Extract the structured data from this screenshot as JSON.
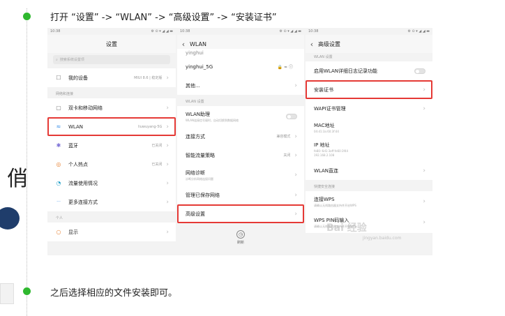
{
  "steps": [
    {
      "text": "打开 “设置” -> “WLAN” -> “高级设置” -> “安装证书”"
    },
    {
      "text": "之后选择相应的文件安装即可。"
    }
  ],
  "left_partial_char": "俏",
  "phone1": {
    "time": "10:38",
    "status_icons": "⚙ ⊙ ▾ ◢ ◢ ▬",
    "title": "设置",
    "search_placeholder": "搜索系统设置项",
    "rows_top": [
      {
        "icon": "☐",
        "icon_name": "phone-icon",
        "label": "我的设备",
        "value": "MIUI 8.6 | 稳定版"
      }
    ],
    "section_network": "网络和连接",
    "rows_network": [
      {
        "icon": "▢",
        "icon_name": "sim-card-icon",
        "label": "双卡和移动网络",
        "value": ""
      },
      {
        "icon": "≈",
        "icon_name": "wifi-icon",
        "label": "WLAN",
        "value": "liuwuyang-5G"
      },
      {
        "icon": "✱",
        "icon_name": "bluetooth-icon",
        "label": "蓝牙",
        "value": "已关闭"
      },
      {
        "icon": "◎",
        "icon_name": "hotspot-icon",
        "label": "个人热点",
        "value": "已关闭"
      },
      {
        "icon": "◔",
        "icon_name": "data-usage-icon",
        "label": "流量使用情况",
        "value": ""
      },
      {
        "icon": "···",
        "icon_name": "more-connections-icon",
        "label": "更多连接方式",
        "value": ""
      }
    ],
    "section_personal": "个人",
    "rows_personal": [
      {
        "icon": "○",
        "icon_name": "display-icon",
        "label": "显示",
        "value": ""
      }
    ]
  },
  "phone2": {
    "time": "10:38",
    "status_icons": "⚙ ⊙ ▾ ◢ ◢ ▬",
    "title": "WLAN",
    "rows_top": [
      {
        "label": "yinghui",
        "value": ""
      },
      {
        "label": "yinghui_5G",
        "badge": "5G",
        "value": "🔒 ≈ ⓘ"
      },
      {
        "label": "其他...",
        "value": ""
      }
    ],
    "section_wlan": "WLAN 设置",
    "assistant_label": "WLAN助理",
    "assistant_sub": "WLAN连接信号弱时，自动切换到数据网络",
    "rows_settings": [
      {
        "label": "连接方式",
        "value": "兼容模式"
      },
      {
        "label": "智能流量策略",
        "value": "关闭"
      }
    ],
    "diagnose_label": "网络诊断",
    "diagnose_sub": "诊断分析网络连接问题",
    "saved_label": "管理已保存网络",
    "advanced_label": "高级设置",
    "refresh_label": "刷新"
  },
  "phone3": {
    "time": "10:38",
    "status_icons": "⚙ ⊙ ▾ ◢ ◢ ▬",
    "title": "高级设置",
    "section_wlan": "WLAN 设置",
    "log_label": "启用WLAN详细日志记录功能",
    "install_cert_label": "安装证书",
    "wapi_label": "WAPI证书管理",
    "mac_label": "MAC地址",
    "mac_value": "04:d1:3a:60:3f:44",
    "ip_label": "IP 地址",
    "ip_value_1": "fe80::6d1:3aff:fe60:3f44",
    "ip_value_2": "192.168.2.108",
    "direct_label": "WLAN直连",
    "section_quick": "快捷安全连接",
    "wps_label": "连接WPS",
    "wps_sub": "请确认无线路由器支持并开启WPS",
    "wps_pin_label": "WPS PIN码输入",
    "wps_pin_sub": "请确认无线路由器支持并开启WPS"
  },
  "watermark": "Bai 经验",
  "watermark_sub": "jingyan.baidu.com"
}
